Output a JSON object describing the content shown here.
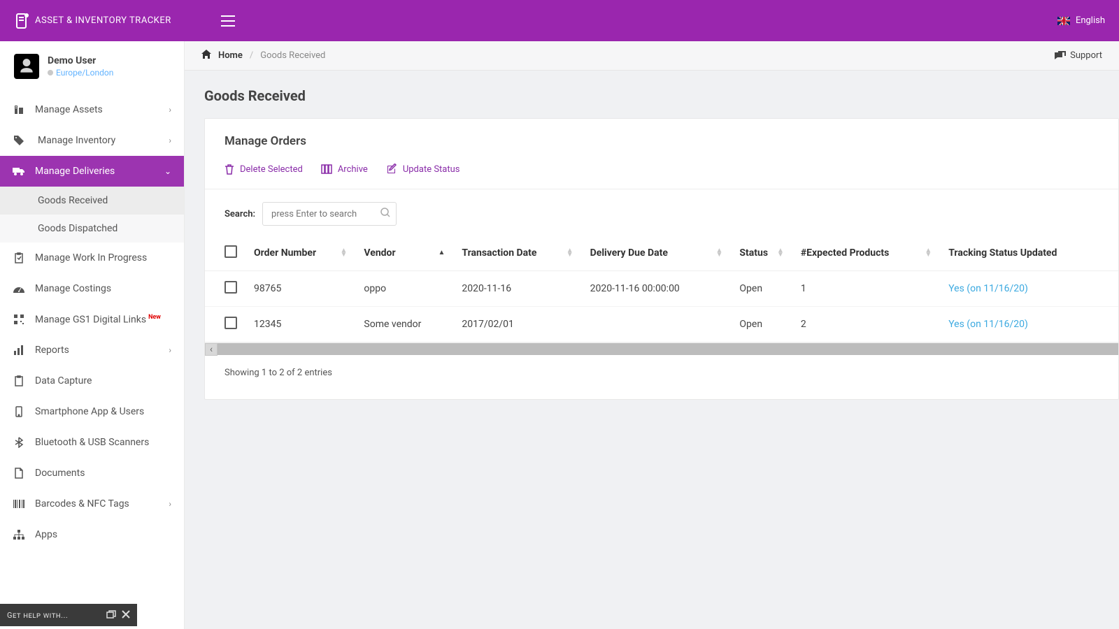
{
  "app_name": "ASSET & INVENTORY TRACKER",
  "language_label": "English",
  "user": {
    "name": "Demo User",
    "tz": "Europe/London"
  },
  "sidebar": {
    "items": [
      {
        "label": "Manage Assets",
        "expandable": true
      },
      {
        "label": "Manage Inventory",
        "expandable": true
      },
      {
        "label": "Manage Deliveries",
        "expandable": true,
        "active": true
      },
      {
        "label": "Manage Work In Progress"
      },
      {
        "label": "Manage Costings"
      },
      {
        "label": "Manage GS1 Digital Links",
        "newBadge": "New"
      },
      {
        "label": "Reports",
        "expandable": true
      },
      {
        "label": "Data Capture"
      },
      {
        "label": "Smartphone App & Users"
      },
      {
        "label": "Bluetooth & USB Scanners"
      },
      {
        "label": "Documents"
      },
      {
        "label": "Barcodes & NFC Tags",
        "expandable": true
      },
      {
        "label": "Apps"
      }
    ],
    "deliveries_sub": [
      {
        "label": "Goods Received",
        "selected": true
      },
      {
        "label": "Goods Dispatched"
      }
    ]
  },
  "help_chip": "Get help with...",
  "breadcrumb": {
    "home": "Home",
    "current": "Goods Received",
    "support": "Support"
  },
  "page_title": "Goods Received",
  "card_title": "Manage Orders",
  "actions": {
    "delete": "Delete Selected",
    "archive": "Archive",
    "update": "Update Status"
  },
  "search": {
    "label": "Search:",
    "placeholder": "press Enter to search"
  },
  "columns": {
    "order_number": "Order Number",
    "vendor": "Vendor",
    "transaction_date": "Transaction Date",
    "delivery_due": "Delivery Due Date",
    "status": "Status",
    "expected": "#Expected Products",
    "tracking": "Tracking Status Updated"
  },
  "rows": [
    {
      "order_number": "98765",
      "vendor": "oppo",
      "transaction_date": "2020-11-16",
      "delivery_due": "2020-11-16 00:00:00",
      "status": "Open",
      "expected": "1",
      "tracking": "Yes (on 11/16/20)"
    },
    {
      "order_number": "12345",
      "vendor": "Some vendor",
      "transaction_date": "2017/02/01",
      "delivery_due": "",
      "status": "Open",
      "expected": "2",
      "tracking": "Yes (on 11/16/20)"
    }
  ],
  "entries_text": "Showing 1 to 2 of 2 entries"
}
